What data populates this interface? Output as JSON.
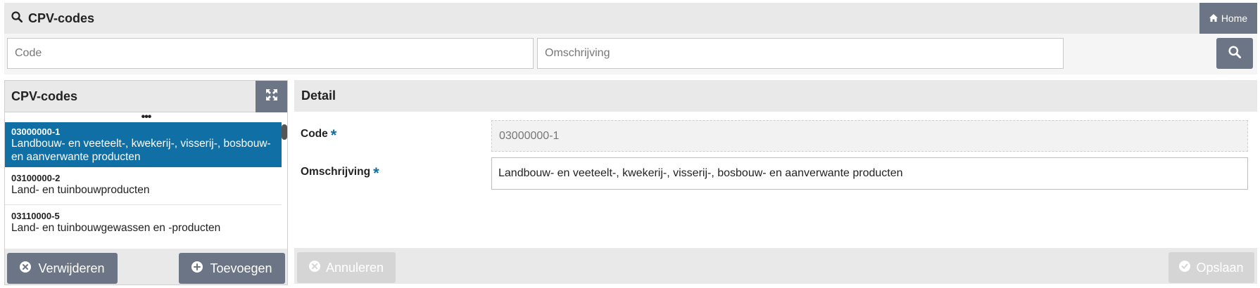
{
  "header": {
    "title": "CPV-codes",
    "search_icon": "search-icon",
    "home_label": "Home",
    "home_icon": "home-icon"
  },
  "search": {
    "code_placeholder": "Code",
    "code_value": "",
    "omschrijving_placeholder": "Omschrijving",
    "omschrijving_value": "",
    "button_icon": "search-icon"
  },
  "list_panel": {
    "title": "CPV-codes",
    "expand_icon": "expand-arrows-icon",
    "more_indicator": "•••",
    "items": [
      {
        "code": "03000000-1",
        "description": "Landbouw- en veeteelt-, kwekerij-, visserij-, bosbouw- en aanverwante producten",
        "selected": true
      },
      {
        "code": "03100000-2",
        "description": "Land- en tuinbouwproducten",
        "selected": false
      },
      {
        "code": "03110000-5",
        "description": "Land- en tuinbouwgewassen en -producten",
        "selected": false
      }
    ],
    "delete_label": "Verwijderen",
    "delete_icon": "x-circle-icon",
    "add_label": "Toevoegen",
    "add_icon": "plus-circle-icon"
  },
  "detail": {
    "title": "Detail",
    "code_label": "Code",
    "code_value": "03000000-1",
    "omschrijving_label": "Omschrijving",
    "omschrijving_value": "Landbouw- en veeteelt-, kwekerij-, visserij-, bosbouw- en aanverwante producten",
    "required_marker": "*",
    "cancel_label": "Annuleren",
    "cancel_icon": "x-circle-icon",
    "save_label": "Opslaan",
    "save_icon": "check-circle-icon"
  },
  "colors": {
    "primary_button": "#6b7586",
    "selected_row": "#106fa5",
    "disabled_button": "#d5d5d5",
    "header_bg": "#e9e9e9",
    "required": "#106fa5"
  }
}
